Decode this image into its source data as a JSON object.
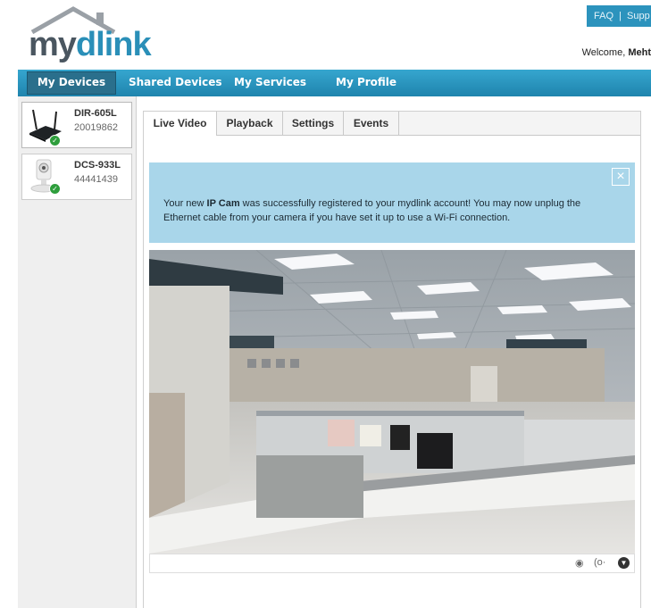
{
  "header": {
    "logo_my": "my",
    "logo_dlink": "dlink",
    "faq": "FAQ",
    "separator": "|",
    "support": "Supp",
    "welcome_prefix": "Welcome,",
    "welcome_name": "Meht"
  },
  "nav": {
    "items": [
      {
        "label": "My Devices",
        "active": true
      },
      {
        "label": "Shared Devices",
        "active": false
      },
      {
        "label": "My Services",
        "active": false
      },
      {
        "label": "My Profile",
        "active": false
      }
    ]
  },
  "sidebar": {
    "devices": [
      {
        "name": "DIR-605L",
        "serial": "20019862",
        "icon": "router-icon",
        "status": "online-check-icon"
      },
      {
        "name": "DCS-933L",
        "serial": "44441439",
        "icon": "camera-icon",
        "status": "online-check-icon"
      }
    ]
  },
  "tabs": [
    {
      "label": "Live Video",
      "active": true
    },
    {
      "label": "Playback",
      "active": false
    },
    {
      "label": "Settings",
      "active": false
    },
    {
      "label": "Events",
      "active": false
    }
  ],
  "notice": {
    "text_before": "Your new ",
    "text_bold": "IP Cam",
    "text_after": " was successfully registered to your mydlink account! You may now unplug the Ethernet cable from your camera if you have set it up to use a Wi-Fi connection.",
    "close_label": "×"
  },
  "video": {
    "icon": "live-camera-feed",
    "controls": [
      {
        "icon": "settings-dot-icon",
        "glyph": "◉"
      },
      {
        "icon": "audio-icon",
        "glyph": "(o·"
      },
      {
        "icon": "chevron-down-icon",
        "glyph": "▼"
      }
    ]
  },
  "colors": {
    "accent": "#2a8fb8",
    "nav_bg": "#2594be",
    "notice_bg": "#a9d6ea",
    "status_ok": "#2e9e3c"
  }
}
